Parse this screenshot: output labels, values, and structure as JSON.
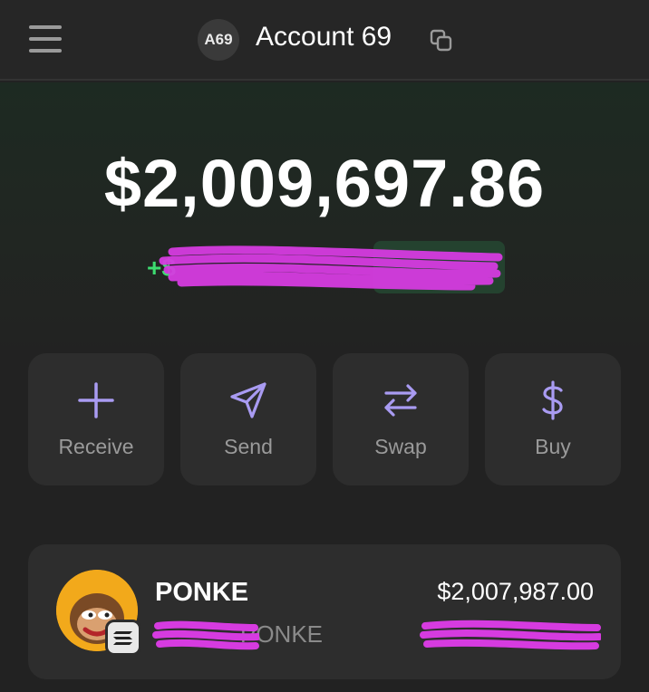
{
  "header": {
    "avatar_text": "A69",
    "account_name": "Account 69"
  },
  "balance": {
    "total": "$2,009,697.86",
    "change_prefix": "+$"
  },
  "actions": [
    {
      "label": "Receive",
      "icon": "plus-icon"
    },
    {
      "label": "Send",
      "icon": "send-icon"
    },
    {
      "label": "Swap",
      "icon": "swap-icon"
    },
    {
      "label": "Buy",
      "icon": "dollar-icon"
    }
  ],
  "tokens": [
    {
      "name": "PONKE",
      "amount_suffix": "PONKE",
      "value": "$2,007,987.00",
      "logo_icon": "ponke-logo",
      "chain_icon": "solana-icon"
    }
  ],
  "colors": {
    "background": "#222222",
    "accent": "#a99bf2",
    "positive": "#3ddc70",
    "redaction": "#d63be0"
  }
}
